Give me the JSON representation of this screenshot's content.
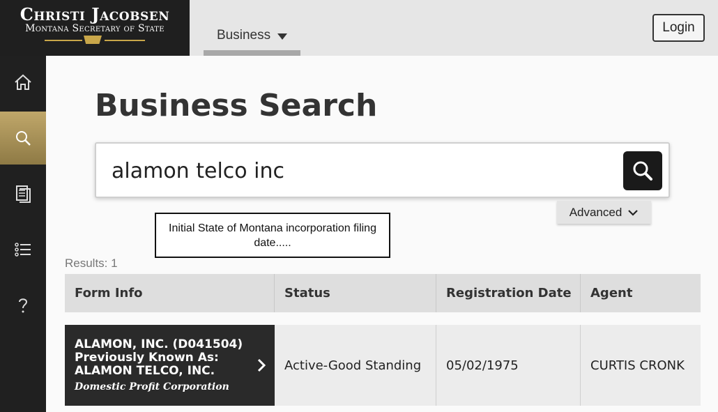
{
  "brand": {
    "name": "Christi Jacobsen",
    "subtitle": "Montana Secretary of State",
    "colors": {
      "gold": "#c9a74a",
      "dark": "#1f1f1f"
    }
  },
  "topbar": {
    "business_tab": "Business",
    "login_label": "Login"
  },
  "sidenav": {
    "items": [
      {
        "icon": "home-icon",
        "active": false
      },
      {
        "icon": "search-icon",
        "active": true
      },
      {
        "icon": "document-icon",
        "active": false
      },
      {
        "icon": "list-icon",
        "active": false
      },
      {
        "icon": "help-icon",
        "active": false
      }
    ]
  },
  "main": {
    "title": "Business Search",
    "search": {
      "value": "alamon telco inc",
      "placeholder": ""
    },
    "advanced_label": "Advanced",
    "annotation": "Initial State of Montana incorporation filing date.....",
    "results_count": "Results: 1"
  },
  "table": {
    "headers": [
      "Form Info",
      "Status",
      "Registration Date",
      "Agent"
    ],
    "rows": [
      {
        "entity_line1": "ALAMON, INC. (D041504)",
        "entity_line2": "Previously Known As:",
        "entity_line3": "ALAMON TELCO, INC.",
        "entity_type": "Domestic Profit Corporation",
        "status": "Active-Good Standing",
        "registration_date": "05/02/1975",
        "agent": "CURTIS CRONK"
      }
    ]
  }
}
